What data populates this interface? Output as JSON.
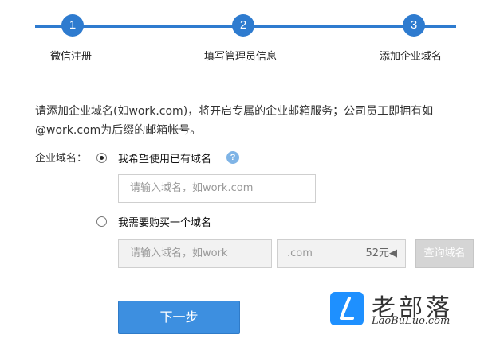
{
  "stepper": {
    "steps": [
      {
        "number": "1",
        "label": "微信注册"
      },
      {
        "number": "2",
        "label": "填写管理员信息"
      },
      {
        "number": "3",
        "label": "添加企业域名"
      }
    ]
  },
  "intro": {
    "line1": "请添加企业域名(如work.com)，将开启专属的企业邮箱服务；公司员工即拥有如",
    "line2": "@work.com为后缀的邮箱帐号。"
  },
  "form": {
    "field_label": "企业域名：",
    "option_existing": {
      "label": "我希望使用已有域名",
      "selected": true
    },
    "existing_input_placeholder": "请输入域名，如work.com",
    "option_buy": {
      "label": "我需要购买一个域名",
      "selected": false
    },
    "buy_input_placeholder": "请输入域名，如work",
    "suffix": ".com",
    "price": "52元◀",
    "query_button": "查询域名",
    "help_icon": "?"
  },
  "next_button": "下一步",
  "watermark": {
    "name": "老部落",
    "url": "LaoBuLuo.com",
    "brand_color": "#1e90ff"
  },
  "colors": {
    "accent": "#2e7bcf",
    "button": "#3d8fe0",
    "disabled": "#d5d5d5"
  }
}
